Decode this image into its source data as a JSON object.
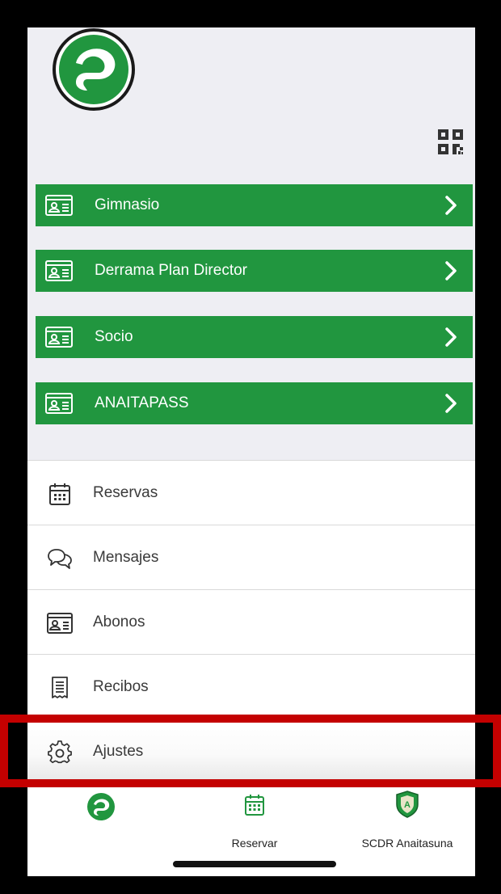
{
  "header": {
    "logo_icon": "anaitasuna-logo-icon",
    "qr_icon": "qr-code-icon"
  },
  "memberships": [
    {
      "label": "Gimnasio",
      "icon": "id-card-icon"
    },
    {
      "label": "Derrama Plan Director",
      "icon": "id-card-icon"
    },
    {
      "label": "Socio",
      "icon": "id-card-icon"
    },
    {
      "label": "ANAITAPASS",
      "icon": "id-card-icon"
    }
  ],
  "menu": [
    {
      "label": "Reservas",
      "icon": "calendar-icon"
    },
    {
      "label": "Mensajes",
      "icon": "chat-bubbles-icon"
    },
    {
      "label": "Abonos",
      "icon": "id-card-icon"
    },
    {
      "label": "Recibos",
      "icon": "receipt-icon"
    },
    {
      "label": "Ajustes",
      "icon": "gear-icon"
    }
  ],
  "tabbar": {
    "home": {
      "label": "",
      "icon": "app-logo-icon"
    },
    "reservar": {
      "label": "Reservar",
      "icon": "calendar-icon"
    },
    "club": {
      "label": "SCDR Anaitasuna",
      "icon": "club-shield-icon"
    }
  },
  "colors": {
    "brand_green": "#21963f",
    "header_bg": "#eeeef3",
    "highlight": "#c40000"
  }
}
